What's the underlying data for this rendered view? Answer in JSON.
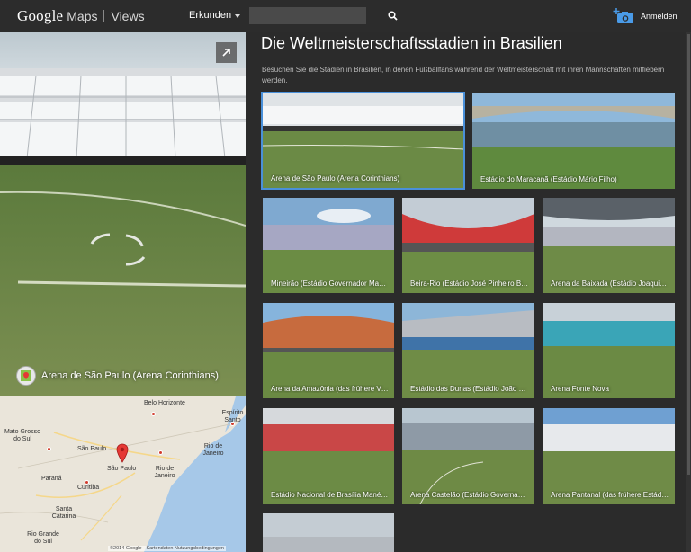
{
  "header": {
    "brand_google": "Google",
    "brand_maps": "Maps",
    "brand_views": "Views",
    "explore_label": "Erkunden",
    "search_placeholder": "",
    "signin_label": "Anmelden"
  },
  "pano": {
    "title": "Arena de São Paulo (Arena Corinthians)"
  },
  "map": {
    "labels": {
      "belo_horizonte": "Belo Horizonte",
      "espirito_santo": "Espírito Santo",
      "mato_grosso": "Mato Grosso do Sul",
      "sao_paulo_state": "São Paulo",
      "rio_state": "Rio de Janeiro",
      "sao_paulo_city": "São Paulo",
      "rio_city": "Rio de Janeiro",
      "parana": "Paraná",
      "curitiba": "Curitiba",
      "santa_catarina": "Santa Catarina",
      "rio_grande": "Rio Grande do Sul"
    },
    "footer": "©2014 Google · Kartendaten  Nutzungsbedingungen"
  },
  "main": {
    "heading": "Die Weltmeisterschaftsstadien in Brasilien",
    "description": "Besuchen Sie die Stadien in Brasilien, in denen Fußballfans während der Weltmeisterschaft mit ihren Mannschaften mitfiebern werden.",
    "tiles": [
      {
        "label": "Arena de São Paulo (Arena Corinthians)"
      },
      {
        "label": "Estádio do Maracanã (Estádio Mário Filho)"
      },
      {
        "label": "Mineirão (Estádio Governador Magalhães Pinto)"
      },
      {
        "label": "Beira-Rio (Estádio José Pinheiro Borda)"
      },
      {
        "label": "Arena da Baixada (Estádio Joaquim Américo)"
      },
      {
        "label": "Arena da Amazônia (das frühere Vivaldão)"
      },
      {
        "label": "Estádio das Dunas (Estádio João Cláudio)"
      },
      {
        "label": "Arena Fonte Nova"
      },
      {
        "label": "Estádio Nacional de Brasília Mané Garrincha"
      },
      {
        "label": "Arena Castelão (Estádio Governador Plácido)"
      },
      {
        "label": "Arena Pantanal (das frühere Estádio Verdão)"
      },
      {
        "label": ""
      }
    ]
  }
}
